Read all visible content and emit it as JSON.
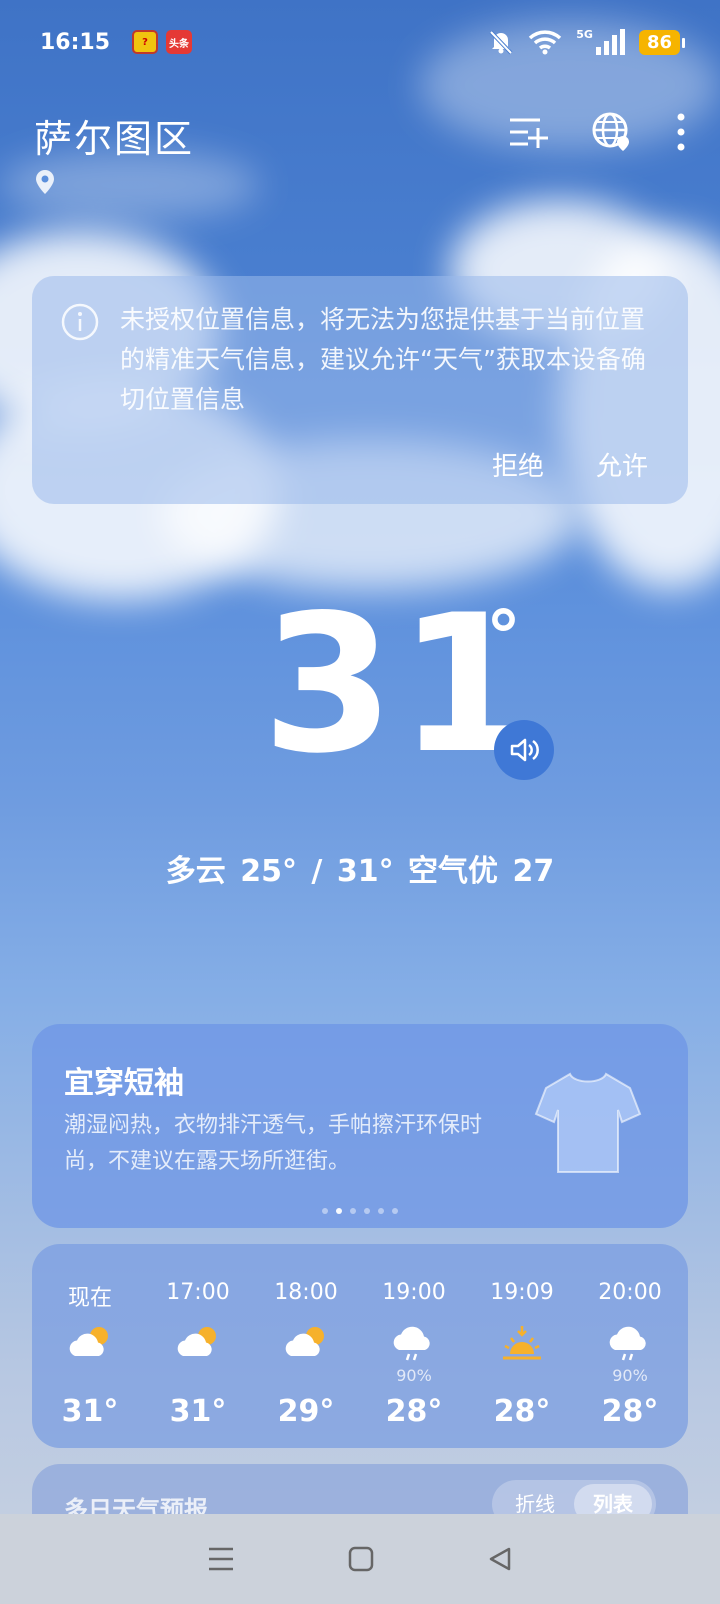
{
  "status_bar": {
    "time": "16:15",
    "app_badges": [
      "头条"
    ],
    "network": "5G",
    "battery": "86"
  },
  "header": {
    "city": "萨尔图区"
  },
  "permission": {
    "message": "未授权位置信息，将无法为您提供基于当前位置的精准天气信息，建议允许“天气”获取本设备确切位置信息",
    "deny_label": "拒绝",
    "allow_label": "允许"
  },
  "current": {
    "temperature": "31",
    "degree": "°",
    "summary": "多云  25° / 31°  空气优 27"
  },
  "clothing": {
    "title": "宜穿短袖",
    "description": "潮湿闷热，衣物排汗透气，手帕擦汗环保时尚，不建议在露天场所逛街。",
    "page_count": 6,
    "active_page": 1
  },
  "hourly": [
    {
      "time": "现在",
      "icon": "partly-cloudy-icon",
      "pop": "",
      "temp": "31°"
    },
    {
      "time": "17:00",
      "icon": "partly-cloudy-icon",
      "pop": "",
      "temp": "31°"
    },
    {
      "time": "18:00",
      "icon": "partly-cloudy-icon",
      "pop": "",
      "temp": "29°"
    },
    {
      "time": "19:00",
      "icon": "rain-icon",
      "pop": "90%",
      "temp": "28°"
    },
    {
      "time": "19:09",
      "icon": "sunset-icon",
      "pop": "",
      "temp": "28°"
    },
    {
      "time": "20:00",
      "icon": "rain-icon",
      "pop": "90%",
      "temp": "28°"
    }
  ],
  "daily": {
    "title": "多日天气预报",
    "toggle_line": "折线",
    "toggle_list": "列表",
    "selected": "列表"
  }
}
